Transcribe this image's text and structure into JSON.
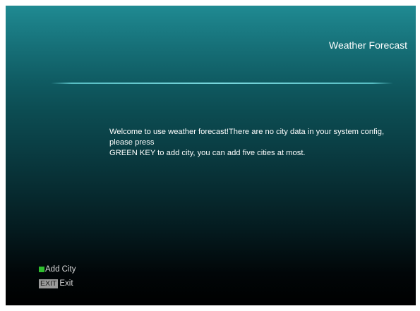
{
  "header": {
    "title": "Weather Forecast"
  },
  "main": {
    "message_line1": "Welcome to use weather forecast!There are no city data in your system config, please press",
    "message_line2": "GREEN KEY to add city, you can add five cities at most."
  },
  "legend": {
    "add_city": {
      "key_color": "#2fbf2f",
      "label": "Add City"
    },
    "exit": {
      "key_label": "EXIT",
      "label": "Exit"
    }
  },
  "colors": {
    "background_top": "#1f8a92",
    "background_bottom": "#000000",
    "divider": "#78d7dc"
  }
}
